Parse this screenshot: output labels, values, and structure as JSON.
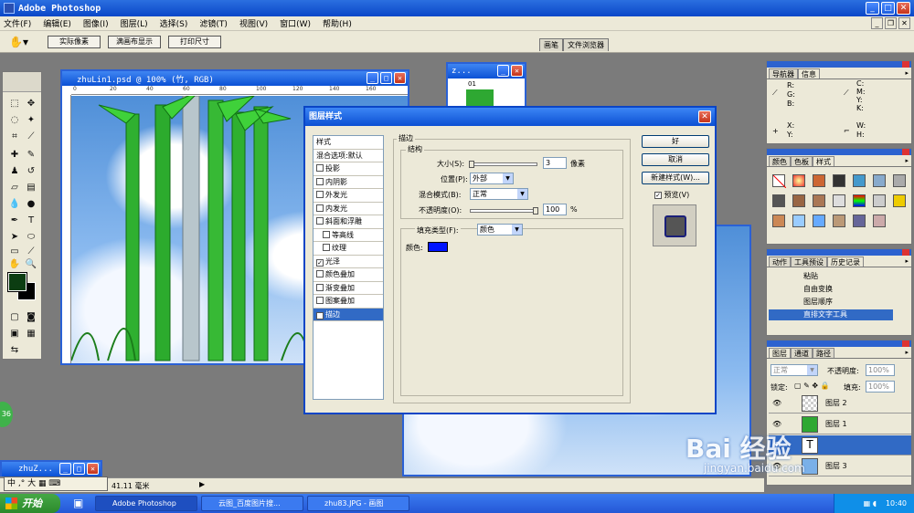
{
  "app": {
    "title": "Adobe Photoshop"
  },
  "menu": [
    "文件(F)",
    "编辑(E)",
    "图像(I)",
    "图层(L)",
    "选择(S)",
    "滤镜(T)",
    "视图(V)",
    "窗口(W)",
    "帮助(H)"
  ],
  "options": {
    "btn_actual": "实际像素",
    "btn_fit": "满画布显示",
    "btn_print": "打印尺寸",
    "tab_brush": "画笔",
    "tab_browser": "文件浏览器"
  },
  "doc1": {
    "title": "zhuLin1.psd @ 100% (竹, RGB)",
    "ruler": [
      "0",
      "20",
      "40",
      "60",
      "80",
      "100",
      "120",
      "140",
      "160",
      "180"
    ]
  },
  "doc2": {
    "title": "z...",
    "label": "01"
  },
  "doc3": {
    "title": "zhuZ..."
  },
  "dialog": {
    "title": "图层样式",
    "styles": [
      {
        "label": "样式",
        "check": false,
        "header": true
      },
      {
        "label": "混合选项:默认",
        "check": false,
        "header": true
      },
      {
        "label": "投影",
        "check": false
      },
      {
        "label": "内阴影",
        "check": false
      },
      {
        "label": "外发光",
        "check": false
      },
      {
        "label": "内发光",
        "check": false
      },
      {
        "label": "斜面和浮雕",
        "check": false
      },
      {
        "label": "等高线",
        "check": false,
        "indent": true
      },
      {
        "label": "纹理",
        "check": false,
        "indent": true
      },
      {
        "label": "光泽",
        "check": true
      },
      {
        "label": "颜色叠加",
        "check": false
      },
      {
        "label": "渐变叠加",
        "check": false
      },
      {
        "label": "图案叠加",
        "check": false
      },
      {
        "label": "描边",
        "check": true,
        "selected": true
      }
    ],
    "stroke": {
      "section": "描边",
      "structure": "结构",
      "size_label": "大小(S):",
      "size_value": "3",
      "size_unit": "像素",
      "position_label": "位置(P):",
      "position_value": "外部",
      "blend_label": "混合模式(B):",
      "blend_value": "正常",
      "opacity_label": "不透明度(O):",
      "opacity_value": "100",
      "opacity_unit": "%",
      "fill_type_label": "填充类型(F):",
      "fill_type_value": "颜色",
      "color_label": "颜色:",
      "color": "#0014ff"
    },
    "buttons": {
      "ok": "好",
      "cancel": "取消",
      "new_style": "新建样式(W)...",
      "preview": "预览(V)"
    }
  },
  "panels": {
    "nav": {
      "tabs": [
        "导航器",
        "信息"
      ],
      "labels": [
        "R:",
        "G:",
        "B:",
        "C:",
        "M:",
        "Y:",
        "K:",
        "X:",
        "Y:",
        "W:",
        "H:"
      ]
    },
    "styles": {
      "tabs": [
        "颜色",
        "色板",
        "样式"
      ]
    },
    "history": {
      "tabs": [
        "动作",
        "工具预设",
        "历史记录"
      ],
      "items": [
        "粘贴",
        "自由变换",
        "图层顺序",
        "直排文字工具"
      ]
    },
    "layers": {
      "tabs": [
        "图层",
        "通道",
        "路径"
      ],
      "mode": "正常",
      "opacity_label": "不透明度:",
      "opacity": "100%",
      "lock_label": "锁定:",
      "fill_label": "填充:",
      "fill": "100%",
      "items": [
        "图层 2",
        "图层 1",
        "",
        "图层 3"
      ]
    }
  },
  "status": {
    "zoom": "41.11 毫米"
  },
  "ime": {
    "text": "中 ,° 大 ▦ ⌨"
  },
  "badge": "36",
  "taskbar": {
    "start": "开始",
    "items": [
      "Adobe Photoshop",
      "云图_百度图片搜...",
      "zhu83.JPG - 画图"
    ],
    "time": "10:40"
  },
  "watermark": {
    "main": "Bai 经验",
    "sub": "jingyan.baidu.com"
  }
}
